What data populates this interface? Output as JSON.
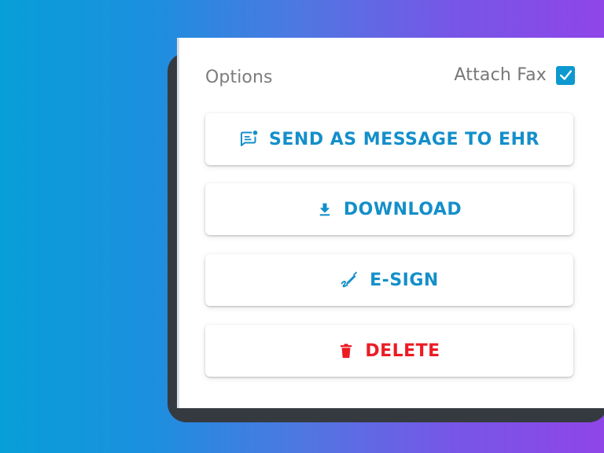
{
  "options": {
    "label": "Options",
    "attach_fax_label": "Attach Fax",
    "attach_fax_checked": true
  },
  "actions": {
    "send_label": "SEND AS MESSAGE TO EHR",
    "download_label": "DOWNLOAD",
    "esign_label": "E-SIGN",
    "delete_label": "DELETE"
  },
  "icons": {
    "send": "message-notification-icon",
    "download": "download-icon",
    "esign": "signature-icon",
    "delete": "trash-icon"
  },
  "colors": {
    "primary": "#148fca",
    "danger": "#ec1b24",
    "checkbox": "#0d98cf",
    "gradient_start": "#079fd8",
    "gradient_end": "#8f45e8"
  }
}
